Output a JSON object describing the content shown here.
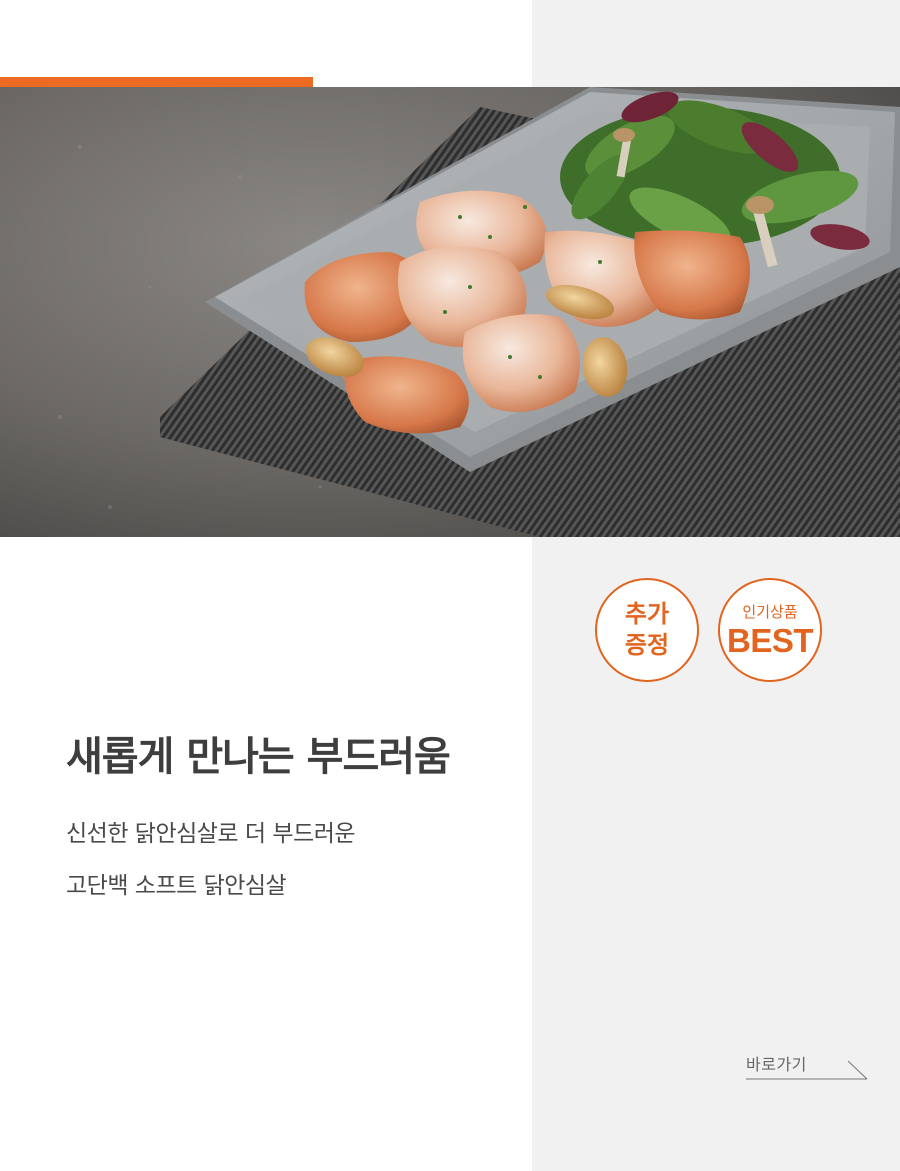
{
  "colors": {
    "accent": "#ec6a21",
    "panel": "#f1f1f1",
    "headline": "#3e3e3e",
    "text": "#4a4a4a"
  },
  "hero": {
    "image_icon": "grilled-chicken-breast-plate-photo"
  },
  "badges": {
    "gift": {
      "line1": "추가",
      "line2": "증정"
    },
    "best": {
      "label": "인기상품",
      "title": "BEST"
    }
  },
  "headline": "새롭게 만나는 부드러움",
  "subcopy": {
    "line1": "신선한 닭안심살로 더 부드러운",
    "line2": "고단백 소프트 닭안심살"
  },
  "goto_link": {
    "label": "바로가기",
    "icon": "arrow-right-icon"
  }
}
